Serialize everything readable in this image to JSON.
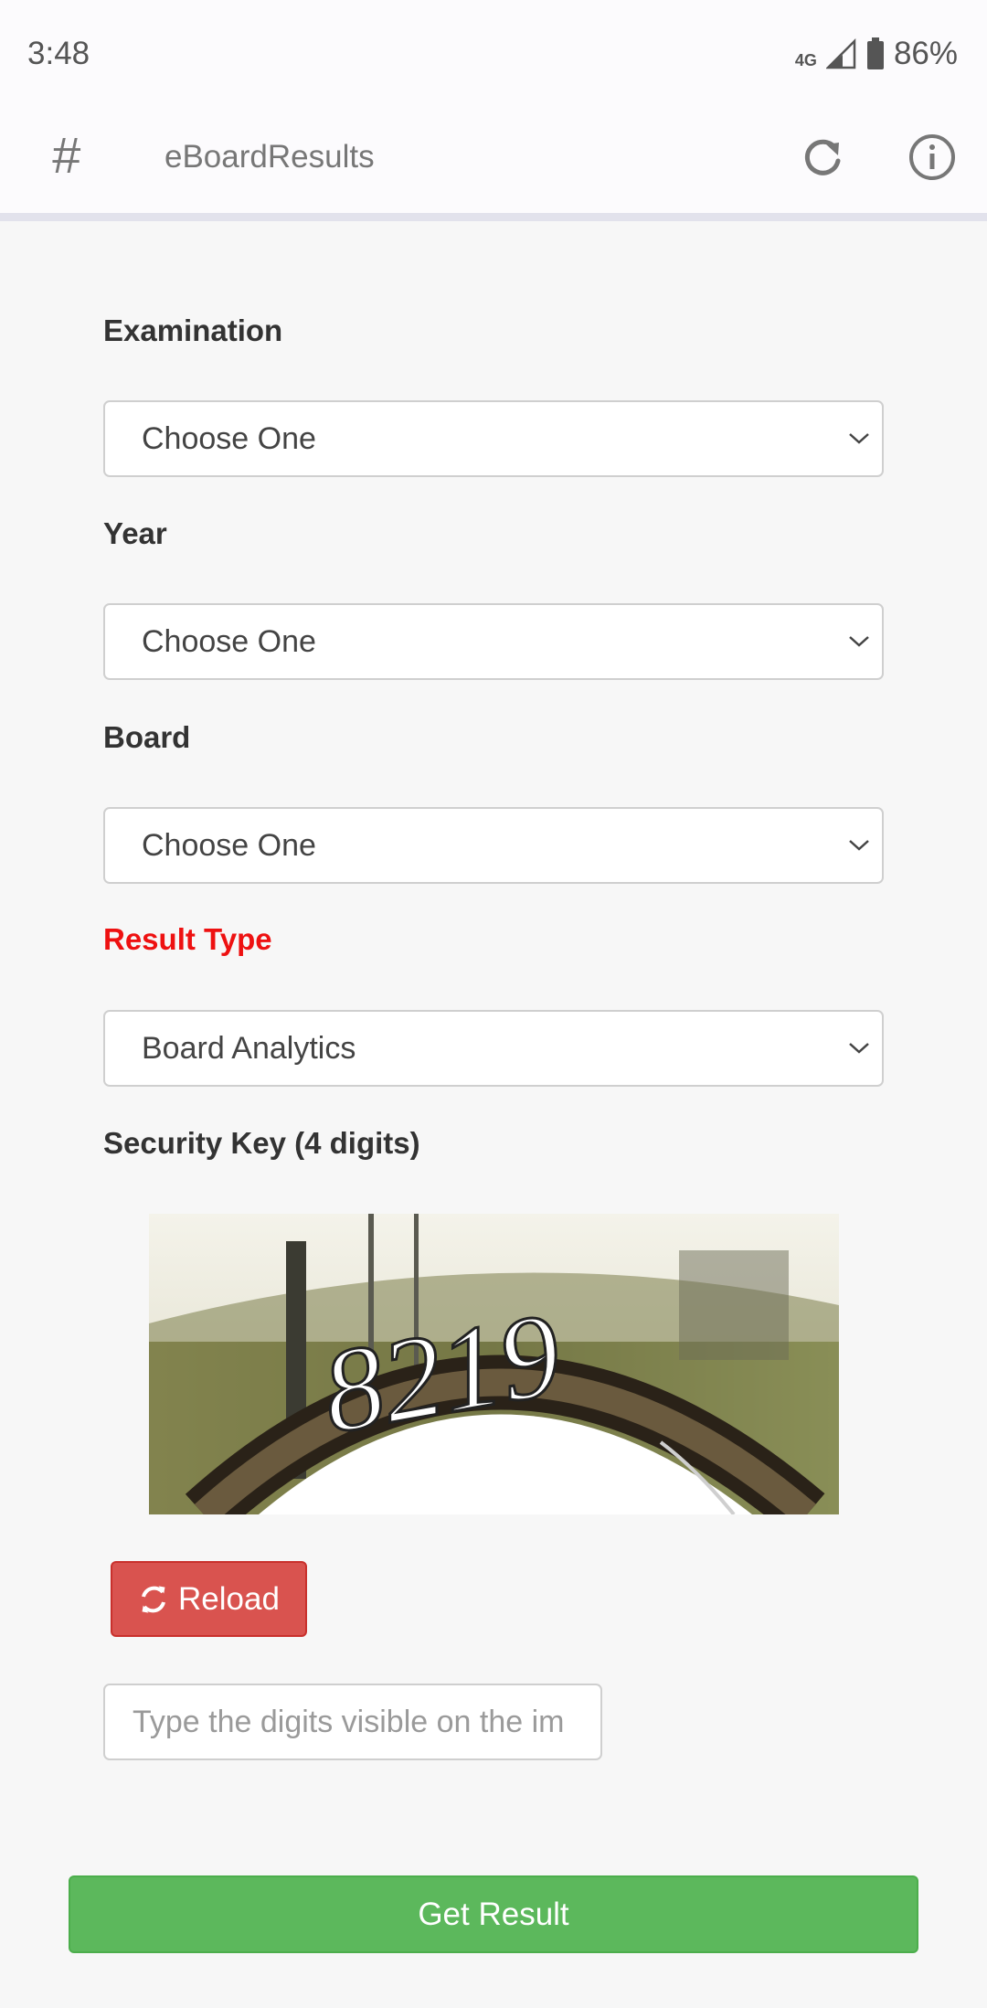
{
  "status_bar": {
    "time": "3:48",
    "network": "4G",
    "battery": "86%"
  },
  "app_bar": {
    "title": "eBoardResults",
    "menu_icon": "hash-icon",
    "refresh_icon": "refresh-icon",
    "info_icon": "info-icon"
  },
  "form": {
    "examination": {
      "label": "Examination",
      "value": "Choose One"
    },
    "year": {
      "label": "Year",
      "value": "Choose One"
    },
    "board": {
      "label": "Board",
      "value": "Choose One"
    },
    "result_type": {
      "label": "Result Type",
      "value": "Board Analytics",
      "label_color": "#ee1111"
    },
    "security": {
      "label": "Security Key (4 digits)",
      "captcha_text": "8219",
      "reload_label": "Reload",
      "input_placeholder": "Type the digits visible on the im",
      "input_value": ""
    },
    "submit_label": "Get Result"
  },
  "colors": {
    "reload_button": "#d9534f",
    "submit_button": "#5cb85c"
  }
}
